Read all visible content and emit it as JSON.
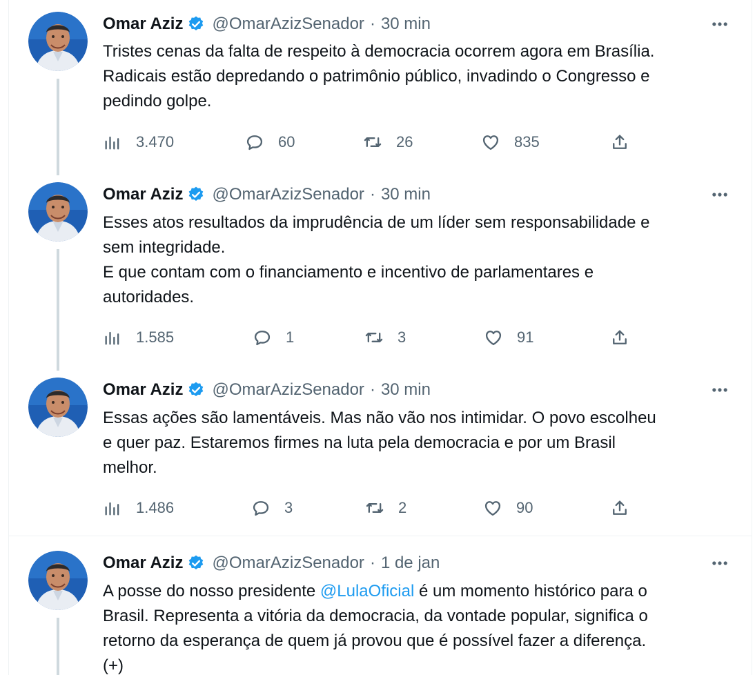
{
  "colors": {
    "accent": "#1d9bf0",
    "text": "#0f1419",
    "secondary": "#536471",
    "thread_line": "#cfd9de",
    "border": "#eff3f4"
  },
  "tweets": [
    {
      "author": "Omar Aziz",
      "handle": "@OmarAzizSenador",
      "separator": "·",
      "time": "30 min",
      "lines": [
        "Tristes cenas da falta de respeito à democracia ocorrem agora em Brasília.",
        "Radicais estão depredando o patrimônio público, invadindo o Congresso e",
        "pedindo golpe."
      ],
      "views": "3.470",
      "replies": "60",
      "retweets": "26",
      "likes": "835"
    },
    {
      "author": "Omar Aziz",
      "handle": "@OmarAzizSenador",
      "separator": "·",
      "time": "30 min",
      "lines": [
        "Esses atos resultados da imprudência de um líder sem responsabilidade e",
        "sem integridade.",
        "E que contam com o financiamento e incentivo de parlamentares e",
        "autoridades."
      ],
      "views": "1.585",
      "replies": "1",
      "retweets": "3",
      "likes": "91"
    },
    {
      "author": "Omar Aziz",
      "handle": "@OmarAzizSenador",
      "separator": "·",
      "time": "30 min",
      "lines": [
        "Essas ações são lamentáveis. Mas não vão nos intimidar. O povo escolheu",
        "e quer paz. Estaremos firmes na luta pela democracia e por um Brasil",
        "melhor."
      ],
      "views": "1.486",
      "replies": "3",
      "retweets": "2",
      "likes": "90"
    },
    {
      "author": "Omar Aziz",
      "handle": "@OmarAzizSenador",
      "separator": "·",
      "time": "1 de jan",
      "line1_before": "A posse do nosso presidente ",
      "line1_mention": "@LulaOficial",
      "line1_after": " é um momento histórico para o",
      "lines": [
        "Brasil. Representa a vitória da democracia, da vontade popular, significa o",
        "retorno da esperança de quem já provou que é possível fazer a diferença.",
        "(+)"
      ]
    }
  ]
}
